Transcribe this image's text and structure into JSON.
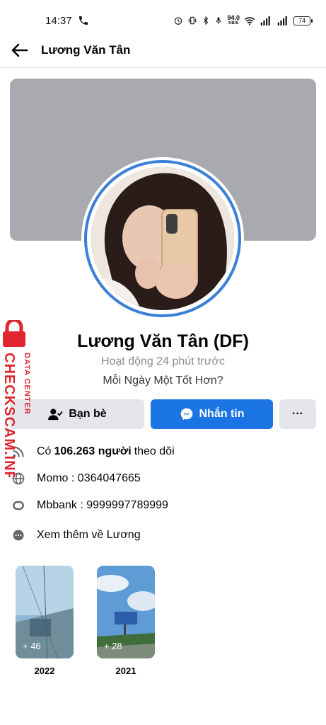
{
  "status_bar": {
    "time": "14:37",
    "net_speed": "94.0",
    "net_unit": "KB/S",
    "battery": "74"
  },
  "app_bar": {
    "title": "Lương Văn Tân"
  },
  "profile": {
    "name": "Lương Văn Tân (DF)",
    "active_status": "Hoạt động 24 phút trước",
    "bio": "Mỗi Ngày Một Tốt Hơn?"
  },
  "actions": {
    "friends_label": "Bạn bè",
    "message_label": "Nhắn tin",
    "more_label": "···"
  },
  "details": {
    "follow_prefix": "Có",
    "follow_count": "106.263 người",
    "follow_suffix": "theo dõi",
    "momo": "Momo : 0364047665",
    "bank": "Mbbank : 9999997789999",
    "see_more": "Xem thêm về Lương"
  },
  "highlights": [
    {
      "count": "+ 46",
      "label": "2022"
    },
    {
      "count": "+ 28",
      "label": "2021"
    }
  ],
  "watermark": {
    "line1": "DATA CENTER",
    "line2": "CHECKSCAM.INFO"
  },
  "colors": {
    "accent": "#1b74e4",
    "ring": "#3b7fd9",
    "watermark": "#e0262e"
  }
}
